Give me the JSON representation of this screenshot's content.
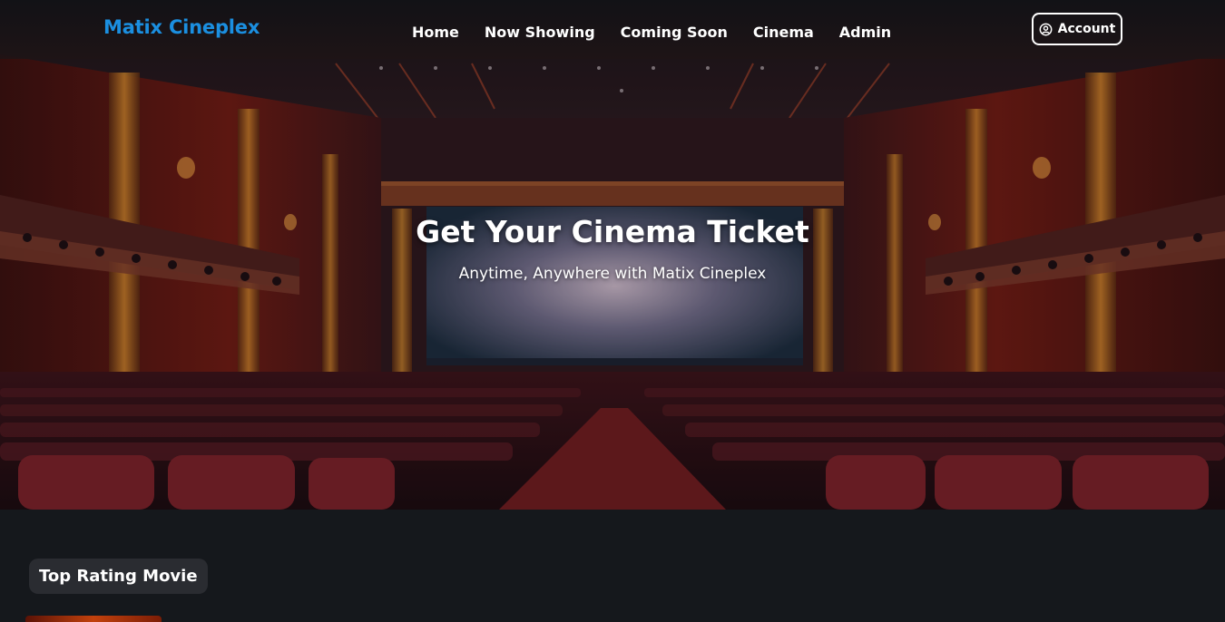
{
  "brand": {
    "name": "Matix Cineplex",
    "color": "#1b8fe0"
  },
  "nav": {
    "links": [
      {
        "label": "Home"
      },
      {
        "label": "Now Showing"
      },
      {
        "label": "Coming Soon"
      },
      {
        "label": "Cinema"
      },
      {
        "label": "Admin"
      }
    ],
    "account": {
      "label": "Account",
      "icon": "user-circle-icon"
    }
  },
  "hero": {
    "title": "Get Your Cinema Ticket",
    "subtitle": "Anytime, Anywhere with Matix Cineplex",
    "image": "cinema-theater-background"
  },
  "sections": [
    {
      "title": "Top Rating Movie"
    }
  ],
  "colors": {
    "page_background": "#15181c",
    "chip_background": "#2a2c31",
    "accent": "#1b8fe0"
  }
}
